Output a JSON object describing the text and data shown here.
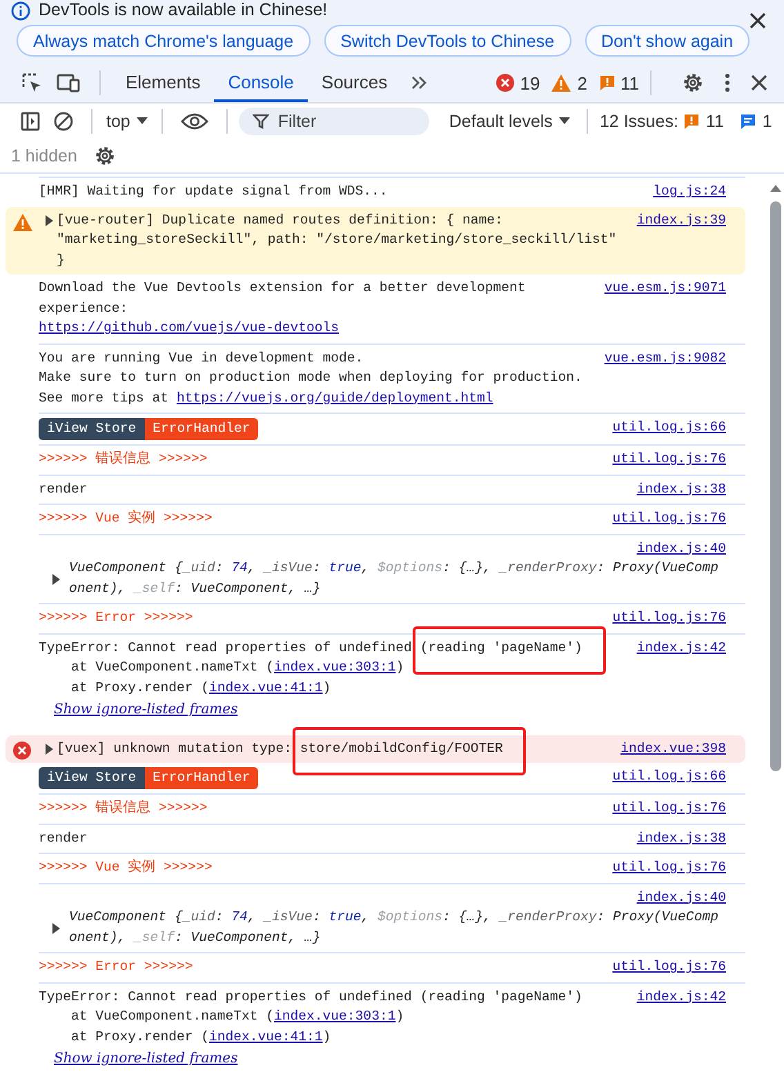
{
  "notice": {
    "message": "DevTools is now available in Chinese!",
    "buttons": [
      "Always match Chrome's language",
      "Switch DevTools to Chinese",
      "Don't show again"
    ]
  },
  "tabs": [
    {
      "label": "Elements",
      "selected": false
    },
    {
      "label": "Console",
      "selected": true
    },
    {
      "label": "Sources",
      "selected": false
    }
  ],
  "counts": [
    {
      "kind": "error",
      "text": "19"
    },
    {
      "kind": "warning",
      "text": "2"
    },
    {
      "kind": "issue",
      "text": "11"
    }
  ],
  "toolbar": {
    "context": "top",
    "filter_placeholder": "Filter",
    "levels": "Default levels",
    "issues_label": "12 Issues:",
    "issues": [
      {
        "kind": "issue",
        "text": "11"
      },
      {
        "kind": "info",
        "text": "1"
      }
    ]
  },
  "hidden": "1 hidden",
  "messages": [
    {
      "kind": "log",
      "source": "log.js:24",
      "lines": [
        {
          "kind": "text",
          "segments": [
            {
              "kind": "plain",
              "text": "[HMR] Waiting for update signal from WDS..."
            }
          ]
        }
      ]
    },
    {
      "kind": "warning",
      "expanded": false,
      "source": "index.js:39",
      "lines": [
        {
          "kind": "text",
          "segments": [
            {
              "kind": "plain",
              "text": "[vue-router] Duplicate named routes definition: { name: \"marketing_storeSeckill\", path: \"/store/marketing/store_seckill/list\" }"
            }
          ]
        }
      ]
    },
    {
      "kind": "log",
      "source": "vue.esm.js:9071",
      "lines": [
        {
          "kind": "text",
          "segments": [
            {
              "kind": "plain",
              "text": "Download the Vue Devtools extension for a better development experience:"
            }
          ]
        },
        {
          "kind": "text",
          "segments": [
            {
              "kind": "link",
              "text": "https://github.com/vuejs/vue-devtools"
            }
          ]
        }
      ]
    },
    {
      "kind": "log",
      "source": "vue.esm.js:9082",
      "lines": [
        {
          "kind": "text",
          "segments": [
            {
              "kind": "plain",
              "text": "You are running Vue in development mode."
            }
          ]
        },
        {
          "kind": "text",
          "segments": [
            {
              "kind": "plain",
              "text": "Make sure to turn on production mode when deploying for production."
            }
          ]
        },
        {
          "kind": "text",
          "segments": [
            {
              "kind": "plain",
              "text": "See more tips at "
            },
            {
              "kind": "link",
              "text": "https://vuejs.org/guide/deployment.html"
            }
          ]
        }
      ]
    },
    {
      "kind": "badges",
      "source": "util.log.js:66",
      "badges": [
        {
          "text": "iView Store",
          "color": "#35495e"
        },
        {
          "text": "ErrorHandler",
          "color": "#f0441b"
        }
      ]
    },
    {
      "kind": "banner",
      "source": "util.log.js:76",
      "lines": [
        {
          "kind": "text",
          "segments": [
            {
              "kind": "plain",
              "text": ">>>>>> 错误信息 >>>>>>"
            }
          ]
        }
      ]
    },
    {
      "kind": "log",
      "source": "index.js:38",
      "lines": [
        {
          "kind": "text",
          "segments": [
            {
              "kind": "plain",
              "text": "render"
            }
          ]
        }
      ]
    },
    {
      "kind": "banner",
      "source": "util.log.js:76",
      "lines": [
        {
          "kind": "text",
          "segments": [
            {
              "kind": "plain",
              "text": ">>>>>> Vue 实例 >>>>>>"
            }
          ]
        }
      ]
    },
    {
      "kind": "object",
      "expanded": false,
      "source": "index.js:40",
      "lines": [
        {
          "kind": "text",
          "segments": [
            {
              "kind": "name",
              "text": "VueComponent "
            },
            {
              "kind": "punct",
              "text": "{"
            },
            {
              "kind": "key",
              "text": "_uid"
            },
            {
              "kind": "punct",
              "text": ": "
            },
            {
              "kind": "number",
              "text": "74"
            },
            {
              "kind": "punct",
              "text": ", "
            },
            {
              "kind": "key",
              "text": "_isVue"
            },
            {
              "kind": "punct",
              "text": ": "
            },
            {
              "kind": "bool",
              "text": "true"
            },
            {
              "kind": "punct",
              "text": ", "
            },
            {
              "kind": "faded",
              "text": "$options"
            },
            {
              "kind": "punct",
              "text": ": {…}, "
            },
            {
              "kind": "key",
              "text": "_renderProxy"
            },
            {
              "kind": "punct",
              "text": ": Proxy(VueComponent), "
            },
            {
              "kind": "faded",
              "text": "_self"
            },
            {
              "kind": "punct",
              "text": ": VueComponent, …}"
            }
          ]
        }
      ]
    },
    {
      "kind": "banner",
      "source": "util.log.js:76",
      "lines": [
        {
          "kind": "text",
          "segments": [
            {
              "kind": "plain",
              "text": ">>>>>> Error >>>>>>"
            }
          ]
        }
      ]
    },
    {
      "kind": "stack",
      "source": "index.js:42",
      "lines": [
        {
          "kind": "text",
          "segments": [
            {
              "kind": "plain",
              "text": "TypeError: Cannot read properties of undefined "
            },
            {
              "kind": "mark",
              "text": "(reading 'pageName')"
            }
          ]
        },
        {
          "kind": "text",
          "segments": [
            {
              "kind": "plain",
              "text": "    at VueComponent.nameTxt ("
            },
            {
              "kind": "link",
              "text": "index.vue:303:1"
            },
            {
              "kind": "plain",
              "text": ")"
            }
          ]
        },
        {
          "kind": "text",
          "segments": [
            {
              "kind": "plain",
              "text": "    at Proxy.render ("
            },
            {
              "kind": "link",
              "text": "index.vue:41:1"
            },
            {
              "kind": "plain",
              "text": ")"
            }
          ]
        },
        {
          "kind": "frames",
          "text": "Show ignore-listed frames"
        }
      ]
    },
    {
      "kind": "error",
      "expanded": false,
      "source": "index.vue:398",
      "lines": [
        {
          "kind": "text",
          "segments": [
            {
              "kind": "plain",
              "text": "[vuex] unknown mutation type: "
            },
            {
              "kind": "mark",
              "text": "store/mobildConfig/FOOTER"
            }
          ]
        }
      ]
    },
    {
      "kind": "badges",
      "source": "util.log.js:66",
      "badges": [
        {
          "text": "iView Store",
          "color": "#35495e"
        },
        {
          "text": "ErrorHandler",
          "color": "#f0441b"
        }
      ]
    },
    {
      "kind": "banner",
      "source": "util.log.js:76",
      "lines": [
        {
          "kind": "text",
          "segments": [
            {
              "kind": "plain",
              "text": ">>>>>> 错误信息 >>>>>>"
            }
          ]
        }
      ]
    },
    {
      "kind": "log",
      "source": "index.js:38",
      "lines": [
        {
          "kind": "text",
          "segments": [
            {
              "kind": "plain",
              "text": "render"
            }
          ]
        }
      ]
    },
    {
      "kind": "banner",
      "source": "util.log.js:76",
      "lines": [
        {
          "kind": "text",
          "segments": [
            {
              "kind": "plain",
              "text": ">>>>>> Vue 实例 >>>>>>"
            }
          ]
        }
      ]
    },
    {
      "kind": "object",
      "expanded": false,
      "source": "index.js:40",
      "lines": [
        {
          "kind": "text",
          "segments": [
            {
              "kind": "name",
              "text": "VueComponent "
            },
            {
              "kind": "punct",
              "text": "{"
            },
            {
              "kind": "key",
              "text": "_uid"
            },
            {
              "kind": "punct",
              "text": ": "
            },
            {
              "kind": "number",
              "text": "74"
            },
            {
              "kind": "punct",
              "text": ", "
            },
            {
              "kind": "key",
              "text": "_isVue"
            },
            {
              "kind": "punct",
              "text": ": "
            },
            {
              "kind": "bool",
              "text": "true"
            },
            {
              "kind": "punct",
              "text": ", "
            },
            {
              "kind": "faded",
              "text": "$options"
            },
            {
              "kind": "punct",
              "text": ": {…}, "
            },
            {
              "kind": "key",
              "text": "_renderProxy"
            },
            {
              "kind": "punct",
              "text": ": Proxy(VueComponent), "
            },
            {
              "kind": "faded",
              "text": "_self"
            },
            {
              "kind": "punct",
              "text": ": VueComponent, …}"
            }
          ]
        }
      ]
    },
    {
      "kind": "banner",
      "source": "util.log.js:76",
      "lines": [
        {
          "kind": "text",
          "segments": [
            {
              "kind": "plain",
              "text": ">>>>>> Error >>>>>>"
            }
          ]
        }
      ]
    },
    {
      "kind": "stack",
      "source": "index.js:42",
      "lines": [
        {
          "kind": "text",
          "segments": [
            {
              "kind": "plain",
              "text": "TypeError: Cannot read properties of undefined (reading 'pageName')"
            }
          ]
        },
        {
          "kind": "text",
          "segments": [
            {
              "kind": "plain",
              "text": "    at VueComponent.nameTxt ("
            },
            {
              "kind": "link",
              "text": "index.vue:303:1"
            },
            {
              "kind": "plain",
              "text": ")"
            }
          ]
        },
        {
          "kind": "text",
          "segments": [
            {
              "kind": "plain",
              "text": "    at Proxy.render ("
            },
            {
              "kind": "link",
              "text": "index.vue:41:1"
            },
            {
              "kind": "plain",
              "text": ")"
            }
          ]
        },
        {
          "kind": "frames",
          "text": "Show ignore-listed frames"
        }
      ]
    }
  ]
}
